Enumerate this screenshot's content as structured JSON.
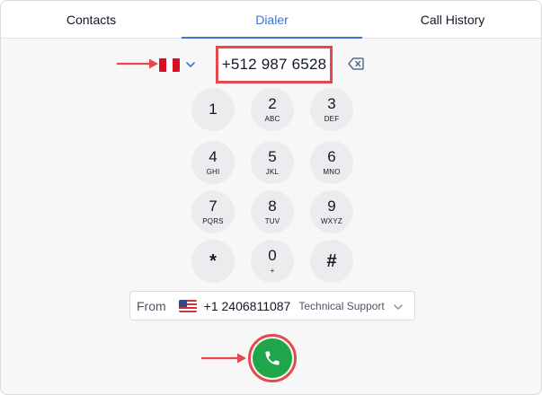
{
  "tabs": [
    {
      "label": "Contacts",
      "active": false
    },
    {
      "label": "Dialer",
      "active": true
    },
    {
      "label": "Call History",
      "active": false
    }
  ],
  "dialer": {
    "country_flag": "peru-flag-icon",
    "number": "+512 987 6528",
    "backspace_icon": "backspace-icon"
  },
  "keypad": [
    {
      "digit": "1",
      "letters": ""
    },
    {
      "digit": "2",
      "letters": "ABC"
    },
    {
      "digit": "3",
      "letters": "DEF"
    },
    {
      "digit": "4",
      "letters": "GHI"
    },
    {
      "digit": "5",
      "letters": "JKL"
    },
    {
      "digit": "6",
      "letters": "MNO"
    },
    {
      "digit": "7",
      "letters": "PQRS"
    },
    {
      "digit": "8",
      "letters": "TUV"
    },
    {
      "digit": "9",
      "letters": "WXYZ"
    },
    {
      "digit": "*",
      "letters": ""
    },
    {
      "digit": "0",
      "letters": "+"
    },
    {
      "digit": "#",
      "letters": ""
    }
  ],
  "from": {
    "label": "From",
    "flag": "us-flag-icon",
    "number": "+1 2406811087",
    "name": "Technical Support"
  },
  "colors": {
    "accent": "#3b73d6",
    "highlight": "#e5484d",
    "call_green": "#1fa64a",
    "key_bg": "#ececee"
  }
}
